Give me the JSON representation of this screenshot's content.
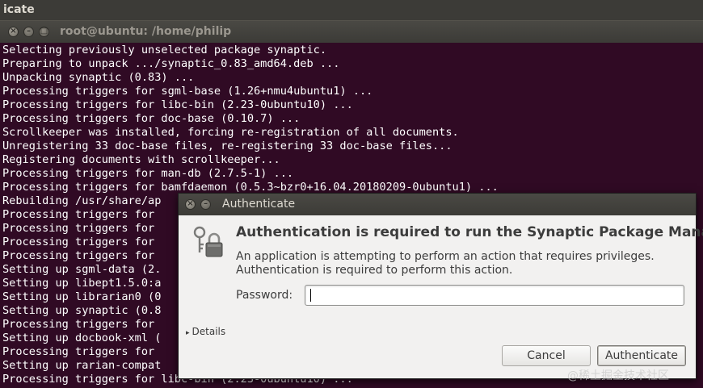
{
  "top_panel": {
    "app_name": "icate"
  },
  "terminal": {
    "title": "root@ubuntu: /home/philip",
    "lines": [
      "Selecting previously unselected package synaptic.",
      "Preparing to unpack .../synaptic_0.83_amd64.deb ...",
      "Unpacking synaptic (0.83) ...",
      "Processing triggers for sgml-base (1.26+nmu4ubuntu1) ...",
      "Processing triggers for libc-bin (2.23-0ubuntu10) ...",
      "Processing triggers for doc-base (0.10.7) ...",
      "Scrollkeeper was installed, forcing re-registration of all documents.",
      "Unregistering 33 doc-base files, re-registering 33 doc-base files...",
      "Registering documents with scrollkeeper...",
      "Processing triggers for man-db (2.7.5-1) ...",
      "Processing triggers for bamfdaemon (0.5.3~bzr0+16.04.20180209-0ubuntu1) ...",
      "Rebuilding /usr/share/ap",
      "Processing triggers for",
      "Processing triggers for",
      "Processing triggers for",
      "Processing triggers for",
      "Setting up sgml-data (2.",
      "Setting up libept1.5.0:a",
      "Setting up librarian0 (0",
      "Setting up synaptic (0.8",
      "Processing triggers for",
      "Setting up docbook-xml (",
      "Processing triggers for",
      "Setting up rarian-compat",
      "Processing triggers for libc-bin (2.23-0ubuntu10) ..."
    ]
  },
  "dialog": {
    "title": "Authenticate",
    "heading": "Authentication is required to run the Synaptic Package Manager",
    "description_line1": "An application is attempting to perform an action that requires privileges.",
    "description_line2": "Authentication is required to perform this action.",
    "password_label": "Password:",
    "password_value": "",
    "details_label": "Details",
    "cancel_label": "Cancel",
    "authenticate_label": "Authenticate",
    "icon": "lock-key-icon"
  },
  "watermark": "@稀土掘金技术社区"
}
